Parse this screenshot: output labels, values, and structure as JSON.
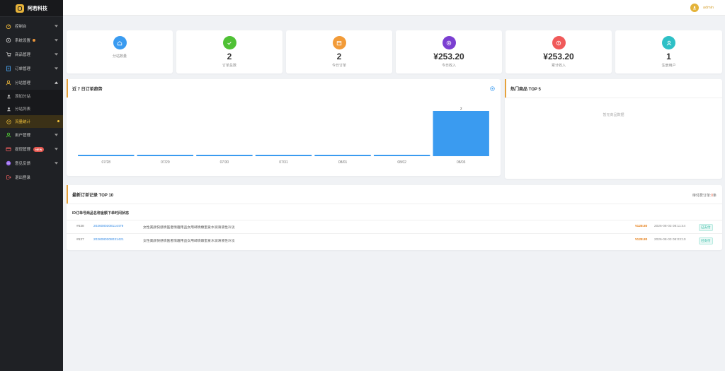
{
  "brand": {
    "name": "阿若科技"
  },
  "sidebar": {
    "items": [
      {
        "label": "控制台",
        "icon": "dashboard-icon"
      },
      {
        "label": "系统设置",
        "icon": "gear-icon"
      },
      {
        "label": "商品管理",
        "icon": "cart-icon"
      },
      {
        "label": "订单管理",
        "icon": "order-icon"
      },
      {
        "label": "分站管理",
        "icon": "branch-icon"
      }
    ],
    "sub_items": [
      {
        "label": "添加分站",
        "icon": "user-add-icon"
      },
      {
        "label": "分站列表",
        "icon": "user-list-icon"
      },
      {
        "label": "流量统计",
        "icon": "stats-icon"
      }
    ],
    "items_after": [
      {
        "label": "用户管理",
        "icon": "user-icon"
      },
      {
        "label": "提现管理",
        "icon": "withdraw-icon",
        "badge": "NEW"
      },
      {
        "label": "意见反馈",
        "icon": "feedback-icon"
      },
      {
        "label": "退出登录",
        "icon": "logout-icon"
      }
    ]
  },
  "header": {
    "user_name": "admin"
  },
  "stats": [
    {
      "value": "",
      "label": "分站数量",
      "color": "#3a9bf0",
      "icon": "home-icon"
    },
    {
      "value": "2",
      "label": "订单总数",
      "color": "#4fc135",
      "icon": "check-icon"
    },
    {
      "value": "2",
      "label": "今日订单",
      "color": "#f29b38",
      "icon": "calendar-icon"
    },
    {
      "value": "¥253.20",
      "label": "今日收入",
      "color": "#7b3fd1",
      "icon": "coin-icon"
    },
    {
      "value": "¥253.20",
      "label": "累计收入",
      "color": "#f05a5a",
      "icon": "money-icon"
    },
    {
      "value": "1",
      "label": "注册用户",
      "color": "#2ec0c6",
      "icon": "users-icon"
    }
  ],
  "trend": {
    "title": "近 7 日订单趋势"
  },
  "top_products": {
    "title": "热门商品 TOP 5",
    "empty_text": "暂无商品数据"
  },
  "orders": {
    "title": "最新订单记录 TOP 10",
    "view_all_prefix": "待付费订单:",
    "view_all_count": "0",
    "view_all_suffix": "条",
    "table_header": "ID订单号商品名称金额下单时间状态",
    "rows": [
      {
        "id": "#638",
        "order_no": "2026080308114479",
        "product": "女性美颜快感情医者情趣用品女用邮情嫩蜜爱水润滑液性冷淡",
        "amount": "¥128.80",
        "time": "2026-08-03 08:11:44",
        "status": "已支付"
      },
      {
        "id": "#637",
        "order_no": "2026080308031421",
        "product": "女性美颜快感情医者情趣用品女用邮情嫩蜜爱水润滑液性冷淡",
        "amount": "¥128.80",
        "time": "2026-08-03 08:03:10",
        "status": "已支付"
      }
    ]
  },
  "chart_data": {
    "type": "bar",
    "title": "近 7 日订单趋势",
    "categories": [
      "07/28",
      "07/29",
      "07/30",
      "07/31",
      "08/01",
      "08/02",
      "08/03"
    ],
    "values": [
      0,
      0,
      0,
      0,
      0,
      0,
      2
    ],
    "data_labels": [
      "",
      "",
      "",
      "",
      "",
      "",
      "2"
    ],
    "color": "#3a9bf0",
    "ylim": [
      0,
      2
    ],
    "grid": false,
    "legend": "none"
  }
}
